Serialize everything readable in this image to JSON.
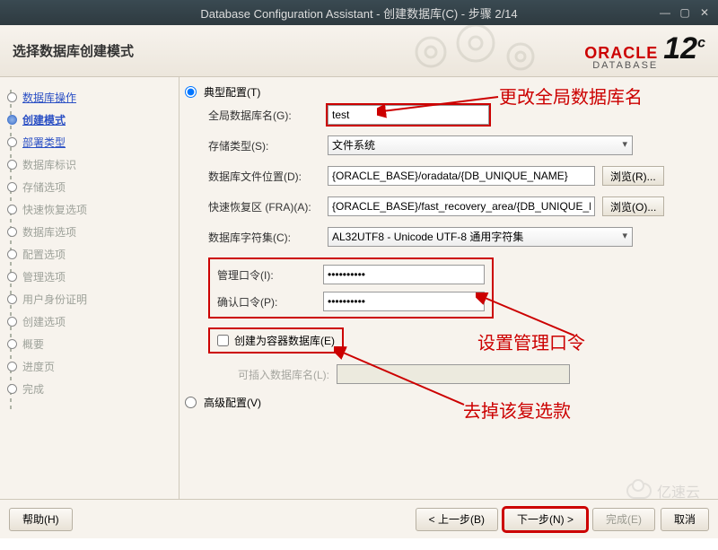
{
  "title": "Database Configuration Assistant - 创建数据库(C) - 步骤 2/14",
  "header_title": "选择数据库创建模式",
  "logo": {
    "brand": "ORACLE",
    "sub": "DATABASE",
    "ver": "12",
    "sup": "c"
  },
  "steps": [
    {
      "label": "数据库操作",
      "state": "link"
    },
    {
      "label": "创建模式",
      "state": "active"
    },
    {
      "label": "部署类型",
      "state": "link"
    },
    {
      "label": "数据库标识",
      "state": "disabled"
    },
    {
      "label": "存储选项",
      "state": "disabled"
    },
    {
      "label": "快速恢复选项",
      "state": "disabled"
    },
    {
      "label": "数据库选项",
      "state": "disabled"
    },
    {
      "label": "配置选项",
      "state": "disabled"
    },
    {
      "label": "管理选项",
      "state": "disabled"
    },
    {
      "label": "用户身份证明",
      "state": "disabled"
    },
    {
      "label": "创建选项",
      "state": "disabled"
    },
    {
      "label": "概要",
      "state": "disabled"
    },
    {
      "label": "进度页",
      "state": "disabled"
    },
    {
      "label": "完成",
      "state": "disabled"
    }
  ],
  "form": {
    "mode_typical": "典型配置(T)",
    "mode_advanced": "高级配置(V)",
    "global_db_label": "全局数据库名(G):",
    "global_db_value": "test",
    "storage_label": "存储类型(S):",
    "storage_value": "文件系统",
    "db_files_label": "数据库文件位置(D):",
    "db_files_value": "{ORACLE_BASE}/oradata/{DB_UNIQUE_NAME}",
    "fra_label": "快速恢复区 (FRA)(A):",
    "fra_value": "{ORACLE_BASE}/fast_recovery_area/{DB_UNIQUE_NAME}",
    "charset_label": "数据库字符集(C):",
    "charset_value": "AL32UTF8 - Unicode UTF-8 通用字符集",
    "admin_pw_label": "管理口令(I):",
    "admin_pw_value": "••••••••••",
    "confirm_pw_label": "确认口令(P):",
    "confirm_pw_value": "••••••••••",
    "container_chk": "创建为容器数据库(E)",
    "pluggable_label": "可插入数据库名(L):",
    "browse_r": "浏览(R)...",
    "browse_o": "浏览(O)..."
  },
  "annotations": {
    "a1": "更改全局数据库名",
    "a2": "设置管理口令",
    "a3": "去掉该复选款"
  },
  "buttons": {
    "help": "帮助(H)",
    "back": "< 上一步(B)",
    "next": "下一步(N) >",
    "finish": "完成(E)",
    "cancel": "取消"
  },
  "watermark": "亿速云"
}
